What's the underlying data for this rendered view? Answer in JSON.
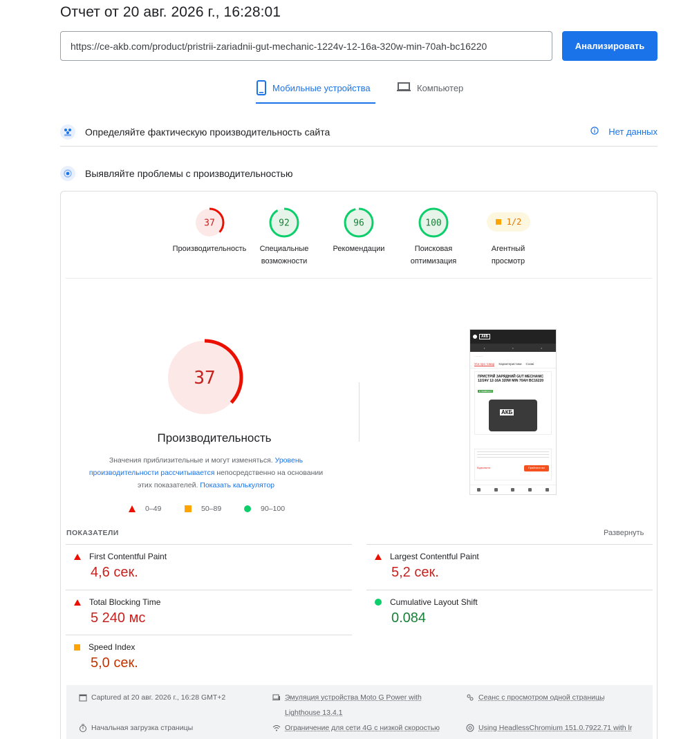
{
  "header": {
    "title": "Отчет от 20 авг. 2026 г., 16:28:01",
    "url": "https://ce-akb.com/product/pristrii-zariadnii-gut-mechanic-1224v-12-16a-320w-min-70ah-bc16220",
    "analyze_label": "Анализировать"
  },
  "tabs": {
    "mobile": "Мобильные устройства",
    "desktop": "Компьютер"
  },
  "sections": {
    "field_title": "Определяйте фактическую производительность сайта",
    "no_data": "Нет данных",
    "lab_title": "Выявляйте проблемы с производительностью"
  },
  "scores": [
    {
      "value": "37",
      "label_line1": "Производительность",
      "label_line2": "",
      "score": 37,
      "color": "#eb0f00",
      "bg": "#fce8e6"
    },
    {
      "value": "92",
      "label_line1": "Специальные",
      "label_line2": "возможности",
      "score": 92,
      "color": "#0cce6b",
      "bg": "#e6f4ea"
    },
    {
      "value": "96",
      "label_line1": "Рекомендации",
      "label_line2": "",
      "score": 96,
      "color": "#0cce6b",
      "bg": "#e6f4ea"
    },
    {
      "value": "100",
      "label_line1": "Поисковая",
      "label_line2": "оптимизация",
      "score": 100,
      "color": "#0cce6b",
      "bg": "#e6f4ea"
    }
  ],
  "agent": {
    "value": "1/2",
    "label_line1": "Агентный",
    "label_line2": "просмотр"
  },
  "performance": {
    "score": "37",
    "fraction": 0.37,
    "title": "Производительность",
    "desc_part1": "Значения приблизительные и могут изменяться. ",
    "desc_link1": "Уровень производительности рассчитывается",
    "desc_part2": " непосредственно на основании этих показателей. ",
    "desc_link2": "Показать калькулятор"
  },
  "legend": {
    "fail": "0–49",
    "average": "50–89",
    "pass": "90–100"
  },
  "metrics": {
    "heading": "ПОКАЗАТЕЛИ",
    "expand": "Развернуть",
    "fcp": {
      "name": "First Contentful Paint",
      "value": "4,6 сек."
    },
    "lcp": {
      "name": "Largest Contentful Paint",
      "value": "5,2 сек."
    },
    "tbt": {
      "name": "Total Blocking Time",
      "value": "5 240 мс"
    },
    "cls": {
      "name": "Cumulative Layout Shift",
      "value": "0.084"
    },
    "si": {
      "name": "Speed Index",
      "value": "5,0 сек."
    }
  },
  "footer": {
    "captured": "Captured at 20 авг. 2026 г., 16:28 GMT+2",
    "emulation_line1": "Эмуляция устройства Moto G Power with",
    "emulation_line2": "Lighthouse 13.4.1",
    "session": "Сеанс с просмотром одной страницы",
    "initial_load": "Начальная загрузка страницы",
    "throttling": "Ограничение для сети 4G с низкой скоростью",
    "browser": "Using HeadlessChromium 151.0.7922.71 with lr"
  },
  "screenshot": {
    "logo": "АКБ",
    "product_title": "ПРИСТРІЙ ЗАРЯДНИЙ GUT MECHANIC 12/24V 12-16A 320W MIN 70AH BC16220",
    "tab_about": "Усе про товар",
    "tab_specs": "Характеристики",
    "tab_other": "Схожі",
    "stock": "в наявності",
    "image_label": "АКБ",
    "cookie_reject": "Відмовити",
    "cookie_accept": "Прийняти всі"
  }
}
